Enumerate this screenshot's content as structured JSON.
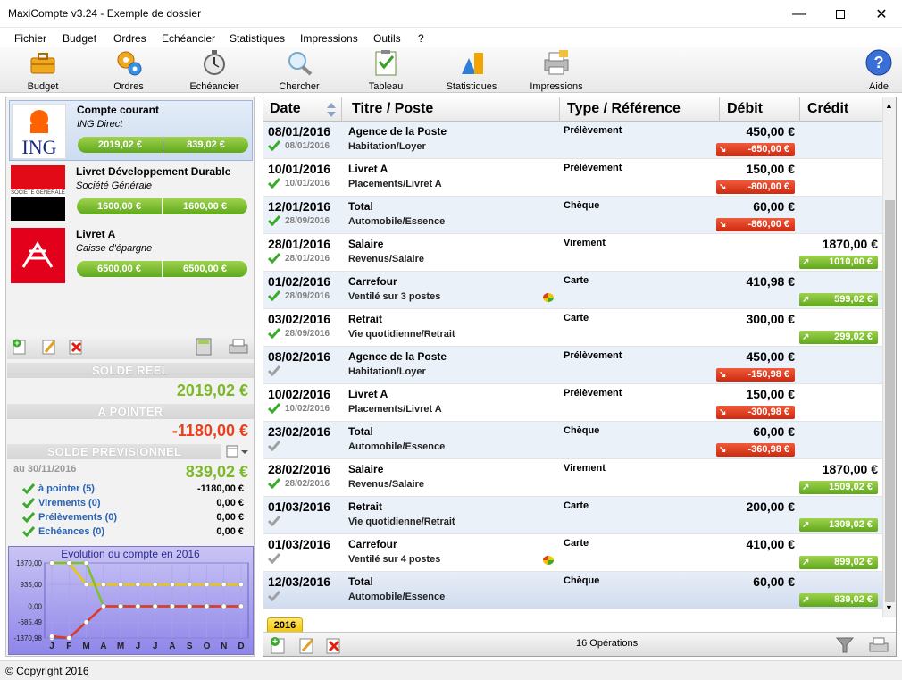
{
  "window": {
    "title": "MaxiCompte v3.24 - Exemple de dossier"
  },
  "menu": [
    "Fichier",
    "Budget",
    "Ordres",
    "Echéancier",
    "Statistiques",
    "Impressions",
    "Outils",
    "?"
  ],
  "toolbar": {
    "budget": "Budget",
    "ordres": "Ordres",
    "echeancier": "Echéancier",
    "chercher": "Chercher",
    "tableau": "Tableau",
    "statistiques": "Statistiques",
    "impressions": "Impressions",
    "aide": "Aide"
  },
  "accounts": [
    {
      "name": "Compte courant",
      "bank": "ING Direct",
      "balance": "2019,02 €",
      "forecast": "839,02 €",
      "logo": "ING"
    },
    {
      "name": "Livret Développement Durable",
      "bank": "Société Générale",
      "balance": "1600,00 €",
      "forecast": "1600,00 €",
      "logo": "SOCIETE GENERALE"
    },
    {
      "name": "Livret A",
      "bank": "Caisse d'épargne",
      "balance": "6500,00 €",
      "forecast": "6500,00 €",
      "logo": "caisse-epargne"
    }
  ],
  "summary": {
    "solde_reel_label": "SOLDE REEL",
    "solde_reel": "2019,02 €",
    "a_pointer_label": "A POINTER",
    "a_pointer": "-1180,00 €",
    "solde_prev_label": "SOLDE PREVISIONNEL",
    "date_label": "au 30/11/2016",
    "solde_prev": "839,02 €",
    "items": [
      {
        "label": "à pointer (5)",
        "value": "-1180,00 €"
      },
      {
        "label": "Virements (0)",
        "value": "0,00 €"
      },
      {
        "label": "Prélèvements (0)",
        "value": "0,00 €"
      },
      {
        "label": "Echéances (0)",
        "value": "0,00 €"
      }
    ]
  },
  "chart_data": {
    "type": "line",
    "title": "Evolution du compte en 2016",
    "categories": [
      "J",
      "F",
      "M",
      "A",
      "M",
      "J",
      "J",
      "A",
      "S",
      "O",
      "N",
      "D"
    ],
    "yticks": [
      "1870,00",
      "935,00",
      "0,00",
      "-685,49",
      "-1370,98"
    ],
    "ylim": [
      -1370.98,
      1870.0
    ],
    "series": [
      {
        "color": "#e8c800",
        "values": [
          1870,
          1870,
          935,
          935,
          935,
          935,
          935,
          935,
          935,
          935,
          935,
          935
        ]
      },
      {
        "color": "#7cc12a",
        "values": [
          1870,
          1870,
          1870,
          0,
          0,
          0,
          0,
          0,
          0,
          0,
          0,
          0
        ]
      },
      {
        "color": "#4a6fd8",
        "values": [
          -1370.98,
          -1370.98,
          -685.49,
          0,
          0,
          0,
          0,
          0,
          0,
          0,
          0,
          0
        ]
      },
      {
        "color": "#e03a20",
        "values": [
          -1300,
          -1370.98,
          -685.49,
          0,
          0,
          0,
          0,
          0,
          0,
          0,
          0,
          0
        ]
      }
    ]
  },
  "table": {
    "headers": {
      "date": "Date",
      "titre": "Titre / Poste",
      "type": "Type / Référence",
      "debit": "Débit",
      "credit": "Crédit"
    },
    "rows": [
      {
        "date": "08/01/2016",
        "subdate": "08/01/2016",
        "title": "Agence de la Poste",
        "poste": "Habitation/Loyer",
        "type": "Prélèvement",
        "debit": "450,00 €",
        "credit": "",
        "balance": "-650,00 €",
        "sign": "neg",
        "checked": true,
        "pie": false
      },
      {
        "date": "10/01/2016",
        "subdate": "10/01/2016",
        "title": "Livret A",
        "poste": "Placements/Livret A",
        "type": "Prélèvement",
        "debit": "150,00 €",
        "credit": "",
        "balance": "-800,00 €",
        "sign": "neg",
        "checked": true,
        "pie": false
      },
      {
        "date": "12/01/2016",
        "subdate": "28/09/2016",
        "title": "Total",
        "poste": "Automobile/Essence",
        "type": "Chèque",
        "debit": "60,00 €",
        "credit": "",
        "balance": "-860,00 €",
        "sign": "neg",
        "checked": true,
        "pie": false
      },
      {
        "date": "28/01/2016",
        "subdate": "28/01/2016",
        "title": "Salaire",
        "poste": "Revenus/Salaire",
        "type": "Virement",
        "debit": "",
        "credit": "1870,00 €",
        "balance": "1010,00 €",
        "sign": "pos",
        "checked": true,
        "pie": false
      },
      {
        "date": "01/02/2016",
        "subdate": "28/09/2016",
        "title": "Carrefour",
        "poste": "Ventilé sur 3 postes",
        "type": "Carte",
        "debit": "410,98 €",
        "credit": "",
        "balance": "599,02 €",
        "sign": "pos",
        "checked": true,
        "pie": true
      },
      {
        "date": "03/02/2016",
        "subdate": "28/09/2016",
        "title": "Retrait",
        "poste": "Vie quotidienne/Retrait",
        "type": "Carte",
        "debit": "300,00 €",
        "credit": "",
        "balance": "299,02 €",
        "sign": "pos",
        "checked": true,
        "pie": false
      },
      {
        "date": "08/02/2016",
        "subdate": "",
        "title": "Agence de la Poste",
        "poste": "Habitation/Loyer",
        "type": "Prélèvement",
        "debit": "450,00 €",
        "credit": "",
        "balance": "-150,98 €",
        "sign": "neg",
        "checked": false,
        "pie": false
      },
      {
        "date": "10/02/2016",
        "subdate": "10/02/2016",
        "title": "Livret A",
        "poste": "Placements/Livret A",
        "type": "Prélèvement",
        "debit": "150,00 €",
        "credit": "",
        "balance": "-300,98 €",
        "sign": "neg",
        "checked": true,
        "pie": false
      },
      {
        "date": "23/02/2016",
        "subdate": "",
        "title": "Total",
        "poste": "Automobile/Essence",
        "type": "Chèque",
        "debit": "60,00 €",
        "credit": "",
        "balance": "-360,98 €",
        "sign": "neg",
        "checked": false,
        "pie": false
      },
      {
        "date": "28/02/2016",
        "subdate": "28/02/2016",
        "title": "Salaire",
        "poste": "Revenus/Salaire",
        "type": "Virement",
        "debit": "",
        "credit": "1870,00 €",
        "balance": "1509,02 €",
        "sign": "pos",
        "checked": true,
        "pie": false
      },
      {
        "date": "01/03/2016",
        "subdate": "",
        "title": "Retrait",
        "poste": "Vie quotidienne/Retrait",
        "type": "Carte",
        "debit": "200,00 €",
        "credit": "",
        "balance": "1309,02 €",
        "sign": "pos",
        "checked": false,
        "pie": false
      },
      {
        "date": "01/03/2016",
        "subdate": "",
        "title": "Carrefour",
        "poste": "Ventilé sur 4 postes",
        "type": "Carte",
        "debit": "410,00 €",
        "credit": "",
        "balance": "899,02 €",
        "sign": "pos",
        "checked": false,
        "pie": true
      },
      {
        "date": "12/03/2016",
        "subdate": "",
        "title": "Total",
        "poste": "Automobile/Essence",
        "type": "Chèque",
        "debit": "60,00 €",
        "credit": "",
        "balance": "839,02 €",
        "sign": "pos",
        "checked": false,
        "pie": false
      }
    ]
  },
  "year_tab": "2016",
  "operations": "16 Opérations",
  "status": "© Copyright 2016"
}
